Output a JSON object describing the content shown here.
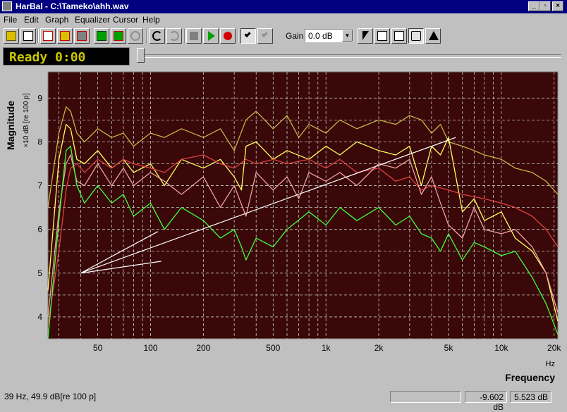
{
  "window": {
    "title": "HarBal - C:\\Tameko\\ahh.wav"
  },
  "menu": [
    "File",
    "Edit",
    "Graph",
    "Equalizer",
    "Cursor",
    "Help"
  ],
  "toolbar": {
    "gain_label": "Gain",
    "gain_value": "0.0 dB",
    "buttons": [
      "open",
      "print",
      "eq-new",
      "eq-open",
      "eq-save",
      "ref-open",
      "ref-save",
      "redo-ref",
      "undo",
      "redo",
      "stop",
      "play",
      "record",
      "eq-check",
      "ref-check",
      "pointer",
      "zoom-in",
      "zoom-out",
      "pan",
      "fit"
    ]
  },
  "status": {
    "ready_text": "Ready  0:00",
    "cursor_readout": "39 Hz, 49.9 dB[re 100 p]",
    "value1": "-9.602 dB",
    "value2": "5.523 dB"
  },
  "chart_data": {
    "type": "line",
    "ylabel": "Magnitude",
    "yunit": "×10 dB [re 100 p]",
    "xlabel": "Frequency",
    "xunit": "Hz",
    "xscale": "log",
    "xlim": [
      26,
      21000
    ],
    "ylim": [
      3.5,
      9.6
    ],
    "yticks": [
      "9",
      "8",
      "7",
      "6",
      "5",
      "4"
    ],
    "xticks": [
      {
        "v": 50,
        "label": "50"
      },
      {
        "v": 100,
        "label": "100"
      },
      {
        "v": 200,
        "label": "200"
      },
      {
        "v": 500,
        "label": "500"
      },
      {
        "v": 1000,
        "label": "1k"
      },
      {
        "v": 2000,
        "label": "2k"
      },
      {
        "v": 5000,
        "label": "5k"
      },
      {
        "v": 10000,
        "label": "10k"
      },
      {
        "v": 20000,
        "label": "20k"
      }
    ],
    "grid": true,
    "series": [
      {
        "color": "#c8b448",
        "x": [
          26,
          30,
          33,
          35,
          38,
          42,
          50,
          60,
          70,
          80,
          100,
          120,
          150,
          200,
          250,
          300,
          350,
          400,
          500,
          600,
          700,
          800,
          1000,
          1200,
          1500,
          2000,
          2500,
          3000,
          3500,
          4000,
          4500,
          5000,
          6000,
          7000,
          8000,
          10000,
          12000,
          15000,
          18000,
          21000
        ],
        "y": [
          6.5,
          8.2,
          8.8,
          8.7,
          8.2,
          8.0,
          8.3,
          8.1,
          8.2,
          7.9,
          8.2,
          8.1,
          8.3,
          8.1,
          8.3,
          7.8,
          8.5,
          8.7,
          8.3,
          8.6,
          8.1,
          8.4,
          8.2,
          8.5,
          8.3,
          8.5,
          8.4,
          8.6,
          8.5,
          8.2,
          8.4,
          8.0,
          7.9,
          7.8,
          7.7,
          7.6,
          7.4,
          7.3,
          7.1,
          6.8
        ]
      },
      {
        "color": "#ffff60",
        "x": [
          26,
          30,
          33,
          35,
          38,
          42,
          50,
          60,
          70,
          80,
          100,
          120,
          150,
          200,
          250,
          300,
          330,
          350,
          400,
          500,
          600,
          800,
          1000,
          1200,
          1500,
          2000,
          2500,
          3000,
          3500,
          4000,
          4500,
          5000,
          6000,
          7000,
          8000,
          10000,
          12000,
          15000,
          18000,
          21000
        ],
        "y": [
          4.6,
          7.6,
          8.4,
          8.3,
          7.6,
          7.5,
          7.8,
          7.4,
          7.6,
          7.3,
          7.5,
          7.0,
          7.6,
          7.4,
          7.6,
          7.2,
          6.9,
          7.9,
          8.0,
          7.6,
          7.8,
          7.6,
          7.9,
          7.7,
          8.0,
          7.8,
          7.7,
          7.9,
          7.0,
          7.9,
          7.7,
          8.1,
          6.4,
          6.7,
          6.2,
          6.4,
          5.8,
          5.5,
          5.0,
          3.9
        ]
      },
      {
        "color": "#e04040",
        "x": [
          26,
          30,
          33,
          35,
          38,
          42,
          50,
          60,
          70,
          80,
          100,
          120,
          150,
          200,
          250,
          300,
          350,
          400,
          500,
          600,
          800,
          1000,
          1200,
          1500,
          2000,
          2500,
          3000,
          3500,
          4000,
          5000,
          6000,
          8000,
          10000,
          12000,
          15000,
          18000,
          21000
        ],
        "y": [
          3.8,
          5.5,
          6.9,
          7.4,
          7.5,
          7.3,
          7.6,
          7.4,
          7.6,
          7.5,
          7.4,
          7.3,
          7.6,
          7.7,
          7.5,
          7.4,
          7.6,
          7.5,
          7.6,
          7.5,
          7.6,
          7.4,
          7.6,
          7.3,
          7.4,
          7.1,
          7.2,
          6.9,
          7.0,
          6.9,
          6.8,
          6.7,
          6.6,
          6.5,
          6.3,
          6.0,
          5.6
        ]
      },
      {
        "color": "#f0a0a0",
        "x": [
          26,
          30,
          33,
          35,
          38,
          42,
          50,
          60,
          70,
          80,
          100,
          120,
          150,
          200,
          250,
          300,
          350,
          400,
          500,
          600,
          700,
          800,
          1000,
          1200,
          1500,
          2000,
          2500,
          3000,
          3500,
          4000,
          4500,
          5000,
          6000,
          7000,
          8000,
          10000,
          12000,
          15000,
          18000,
          21000
        ],
        "y": [
          4.0,
          6.4,
          7.5,
          7.7,
          7.1,
          7.0,
          7.5,
          7.0,
          7.4,
          7.0,
          7.3,
          7.1,
          6.8,
          7.2,
          6.5,
          7.0,
          6.3,
          7.3,
          6.9,
          7.2,
          6.7,
          7.3,
          7.1,
          7.3,
          7.0,
          7.5,
          7.4,
          7.6,
          6.8,
          7.2,
          6.6,
          6.1,
          5.8,
          6.5,
          6.0,
          5.9,
          6.0,
          5.6,
          5.0,
          4.1
        ]
      },
      {
        "color": "#40ff40",
        "x": [
          26,
          30,
          33,
          35,
          38,
          42,
          50,
          60,
          70,
          80,
          100,
          120,
          150,
          200,
          250,
          300,
          330,
          350,
          400,
          500,
          600,
          800,
          1000,
          1200,
          1500,
          2000,
          2500,
          3000,
          3500,
          4000,
          4500,
          5000,
          6000,
          7000,
          8000,
          10000,
          12000,
          15000,
          18000,
          21000
        ],
        "y": [
          3.4,
          6.2,
          7.8,
          7.9,
          7.0,
          6.6,
          7.0,
          6.6,
          6.8,
          6.3,
          6.6,
          6.0,
          6.5,
          6.2,
          5.8,
          6.0,
          5.6,
          5.3,
          5.8,
          5.6,
          6.0,
          6.4,
          6.1,
          6.5,
          6.2,
          6.5,
          6.1,
          6.3,
          5.9,
          5.8,
          5.5,
          5.9,
          5.3,
          5.7,
          5.6,
          5.4,
          5.5,
          4.9,
          4.3,
          3.6
        ]
      },
      {
        "color": "#ffffff",
        "kind": "cursor-line",
        "x": [
          40,
          5500
        ],
        "y": [
          5.0,
          8.1
        ]
      },
      {
        "color": "#ffffff",
        "kind": "cursor-line",
        "x": [
          40,
          110
        ],
        "y": [
          5.0,
          5.95
        ]
      },
      {
        "color": "#ffffff",
        "kind": "cursor-line",
        "x": [
          40,
          115
        ],
        "y": [
          5.0,
          5.27
        ]
      }
    ]
  }
}
